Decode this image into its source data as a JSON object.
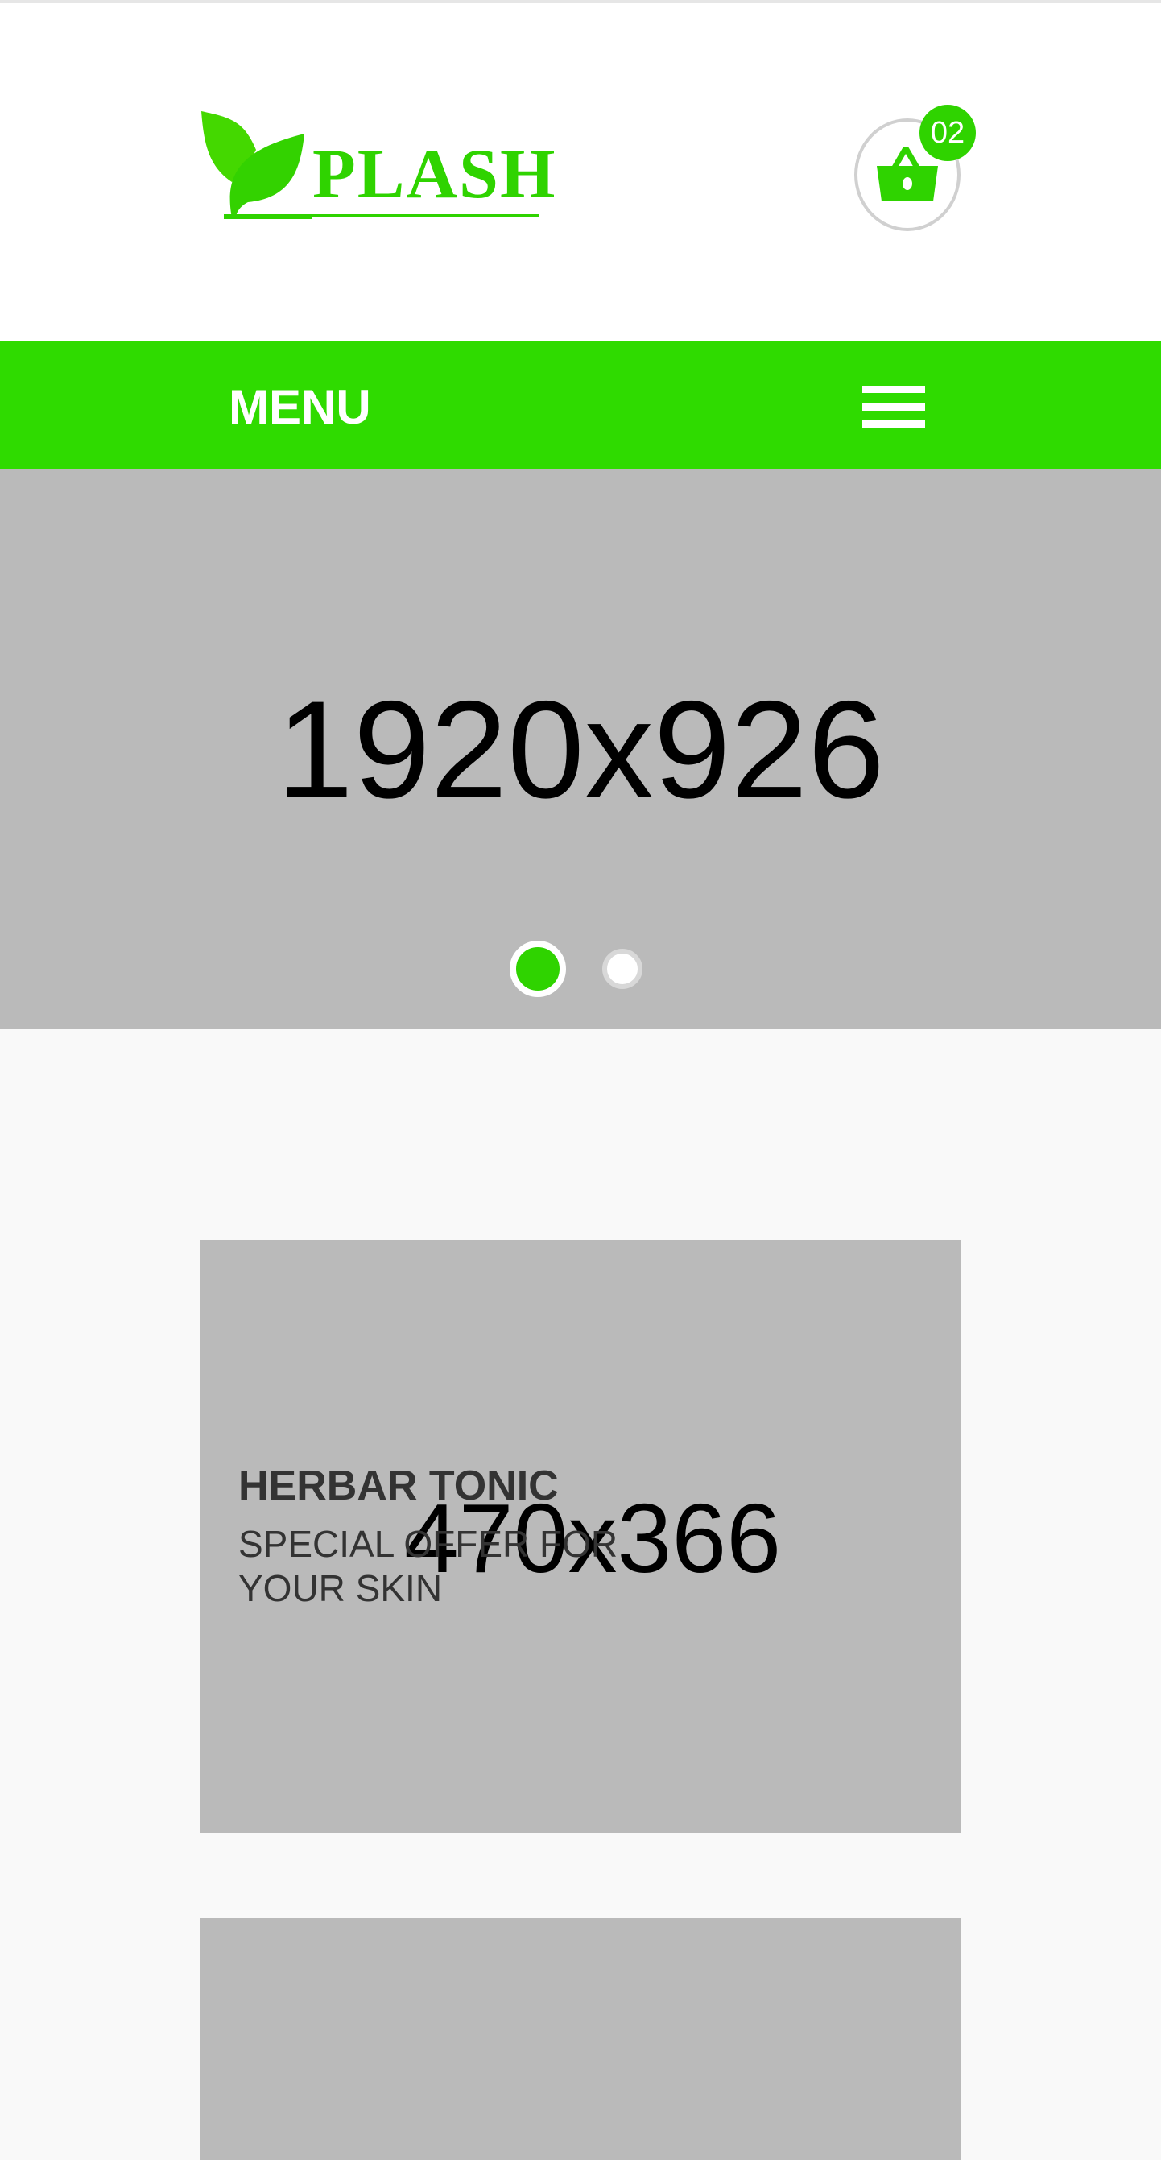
{
  "header": {
    "logo_text": "PLASH",
    "cart_count": "02"
  },
  "nav": {
    "menu_label": "MENU"
  },
  "hero": {
    "placeholder": "1920x926",
    "slides": 2,
    "active_slide": 1
  },
  "cards": [
    {
      "placeholder": "470x366",
      "title": "HERBAR TONIC",
      "subtitle": "SPECIAL OFFER FOR YOUR SKIN"
    }
  ],
  "colors": {
    "accent": "#2fdb00",
    "placeholder": "#bababa"
  }
}
